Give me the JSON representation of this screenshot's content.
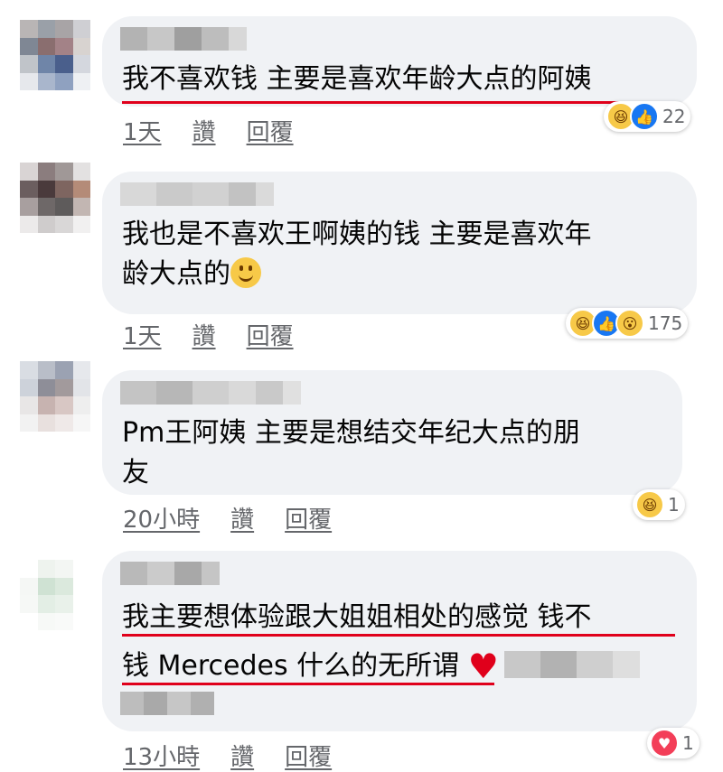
{
  "comments": [
    {
      "text_lines": [
        "我不喜欢钱 主要是喜欢年龄大点的阿姨"
      ],
      "time": "1天",
      "like_label": "讚",
      "reply_label": "回覆",
      "reaction_count": "22",
      "reactions": [
        "haha",
        "like"
      ]
    },
    {
      "text_lines": [
        "我也是不喜欢王啊姨的钱 主要是喜欢年",
        "龄大点的"
      ],
      "time": "1天",
      "like_label": "讚",
      "reply_label": "回覆",
      "reaction_count": "175",
      "reactions": [
        "haha",
        "like",
        "wow"
      ]
    },
    {
      "text_lines": [
        "Pm王阿姨 主要是想结交年纪大点的朋",
        "友"
      ],
      "time": "20小時",
      "like_label": "讚",
      "reply_label": "回覆",
      "reaction_count": "1",
      "reactions": [
        "haha"
      ]
    },
    {
      "text_lines": [
        "我主要想体验跟大姐姐相处的感觉 钱不",
        "钱 Mercedes 什么的无所谓"
      ],
      "time": "13小時",
      "like_label": "讚",
      "reply_label": "回覆",
      "reaction_count": "1",
      "reactions": [
        "love"
      ]
    }
  ],
  "colors": {
    "bubble": "#f0f2f5",
    "underline": "#e0001b",
    "meta_text": "#65676b"
  }
}
